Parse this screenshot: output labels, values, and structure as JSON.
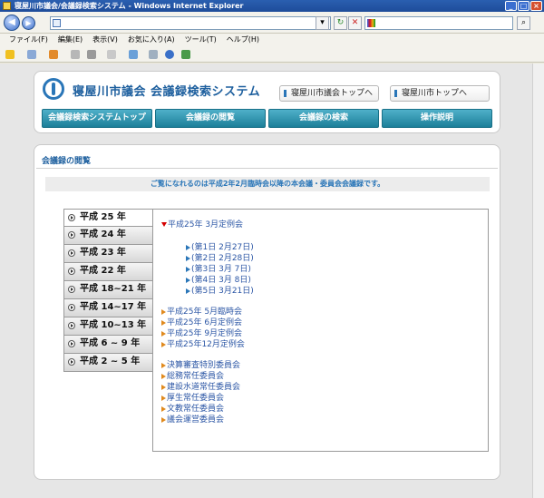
{
  "window": {
    "title": "寝屋川市議会/会議録検索システム - Windows Internet Explorer"
  },
  "menu": [
    "ファイル(F)",
    "編集(E)",
    "表示(V)",
    "お気に入り(A)",
    "ツール(T)",
    "ヘルプ(H)"
  ],
  "site": {
    "title": "寝屋川市議会 会議録検索システム",
    "top_links": [
      "寝屋川市議会トップへ",
      "寝屋川市トップへ"
    ],
    "tabs": [
      "会議録検索システムトップ",
      "会議録の閲覧",
      "会議録の検索",
      "操作説明"
    ]
  },
  "section": {
    "title": "会議録の閲覧",
    "notice": "ご覧になれるのは平成2年2月臨時会以降の本会議・委員会会議録です。"
  },
  "years": [
    "平成 25 年",
    "平成 24 年",
    "平成 23 年",
    "平成 22 年",
    "平成 18~21 年",
    "平成 14~17 年",
    "平成 10~13 年",
    "平成 6 ~ 9 年",
    "平成 2 ~ 5 年"
  ],
  "content": {
    "open_session": "平成25年 3月定例会",
    "days": [
      "(第1日 2月27日)",
      "(第2日 2月28日)",
      "(第3日 3月 7日)",
      "(第4日 3月 8日)",
      "(第5日 3月21日)"
    ],
    "sessions": [
      "平成25年 5月臨時会",
      "平成25年 6月定例会",
      "平成25年 9月定例会",
      "平成25年12月定例会"
    ],
    "committees": [
      "決算審査特別委員会",
      "総務常任委員会",
      "建設水道常任委員会",
      "厚生常任委員会",
      "文教常任委員会",
      "議会運営委員会"
    ]
  }
}
